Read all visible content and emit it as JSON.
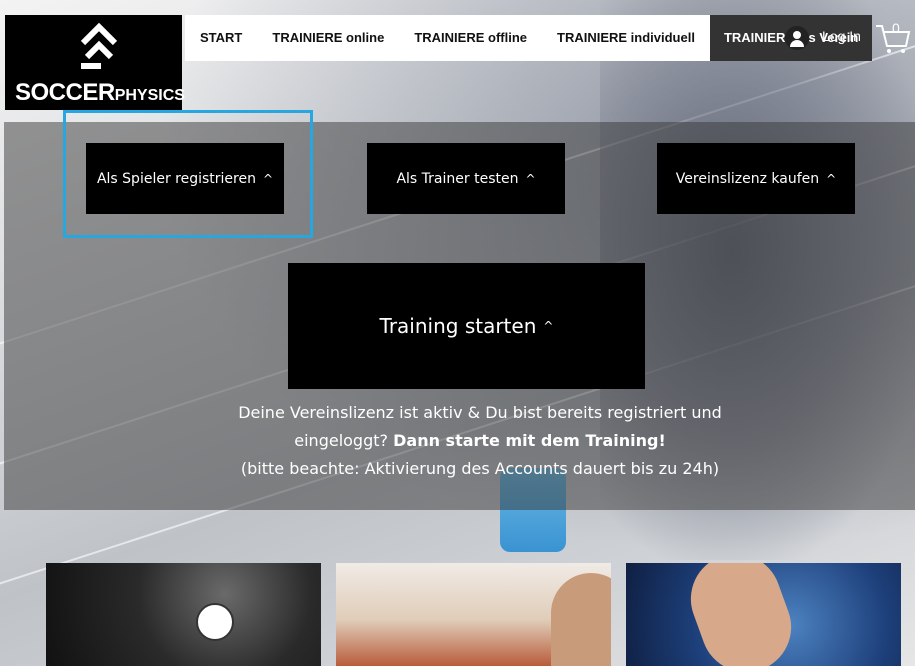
{
  "brand": {
    "name_main": "SOCCER",
    "name_suffix": "PHYSICS",
    "icon": "upward-arrow-logo-icon"
  },
  "nav": {
    "items": [
      {
        "label": "START"
      },
      {
        "label": "TRAINIERE online"
      },
      {
        "label": "TRAINIERE offline"
      },
      {
        "label": "TRAINIERE individuell"
      },
      {
        "label": "TRAINIERE als Verein",
        "active": true
      }
    ]
  },
  "header": {
    "login_label": "Log In",
    "user_icon": "user-avatar-icon",
    "cart_icon": "shopping-cart-icon",
    "cart_count": "0"
  },
  "cta_buttons": [
    {
      "label": "Als Spieler registrieren",
      "chevron": "^"
    },
    {
      "label": "Als Trainer testen",
      "chevron": "^"
    },
    {
      "label": "Vereinslizenz kaufen",
      "chevron": "^"
    }
  ],
  "start_button": {
    "label": "Training starten",
    "chevron": "^"
  },
  "info": {
    "line1": "Deine Vereinslizenz ist aktiv & Du bist bereits registriert und",
    "line2_normal": "eingeloggt?",
    "line2_bold": "Dann starte mit dem Training!",
    "line3": "(bitte beachte: Aktivierung des Accounts dauert bis zu 24h)"
  },
  "colors": {
    "highlight_border": "#27a6e0",
    "button_bg": "#000000",
    "nav_active_bg": "#333333"
  }
}
